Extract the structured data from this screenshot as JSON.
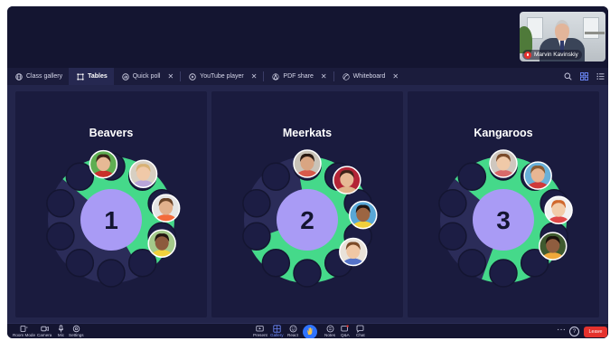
{
  "self_view": {
    "name": "Marvin Kavinskiy"
  },
  "tabs": [
    {
      "label": "Class gallery",
      "icon": "globe-icon",
      "active": false,
      "closable": false
    },
    {
      "label": "Tables",
      "icon": "tables-icon",
      "active": true,
      "closable": false
    },
    {
      "label": "Quick poll",
      "icon": "poll-icon",
      "active": false,
      "closable": true
    },
    {
      "label": "YouTube player",
      "icon": "play-icon",
      "active": false,
      "closable": true
    },
    {
      "label": "PDF share",
      "icon": "pdf-icon",
      "active": false,
      "closable": true
    },
    {
      "label": "Whiteboard",
      "icon": "whiteboard-icon",
      "active": false,
      "closable": true
    }
  ],
  "tables": [
    {
      "title": "Beavers",
      "number": "1",
      "green_range": [
        -50,
        150
      ]
    },
    {
      "title": "Meerkats",
      "number": "2",
      "green_range": [
        -10,
        250
      ]
    },
    {
      "title": "Kangaroos",
      "number": "3",
      "green_range": [
        -50,
        200
      ]
    }
  ],
  "bottom_left": [
    {
      "label": "Room Mode",
      "icon": "room-mode-icon"
    },
    {
      "label": "Camera",
      "icon": "camera-icon"
    },
    {
      "label": "Mic",
      "icon": "mic-icon"
    },
    {
      "label": "Settings",
      "icon": "settings-icon"
    }
  ],
  "bottom_center": [
    {
      "label": "Present",
      "icon": "present-icon"
    },
    {
      "label": "Gallery",
      "icon": "gallery-icon",
      "active": true
    },
    {
      "label": "React",
      "icon": "react-icon"
    },
    {
      "label": "Notes",
      "icon": "notes-icon"
    },
    {
      "label": "Q&A",
      "icon": "qa-icon"
    },
    {
      "label": "Chat",
      "icon": "chat-icon"
    }
  ],
  "leave_label": "Leave",
  "help_label": "?",
  "more_label": "···",
  "colors": {
    "accent_green": "#45d98a",
    "seat_empty": "#3a3c6a",
    "center": "#a99bf5",
    "leave": "#e5322d"
  }
}
